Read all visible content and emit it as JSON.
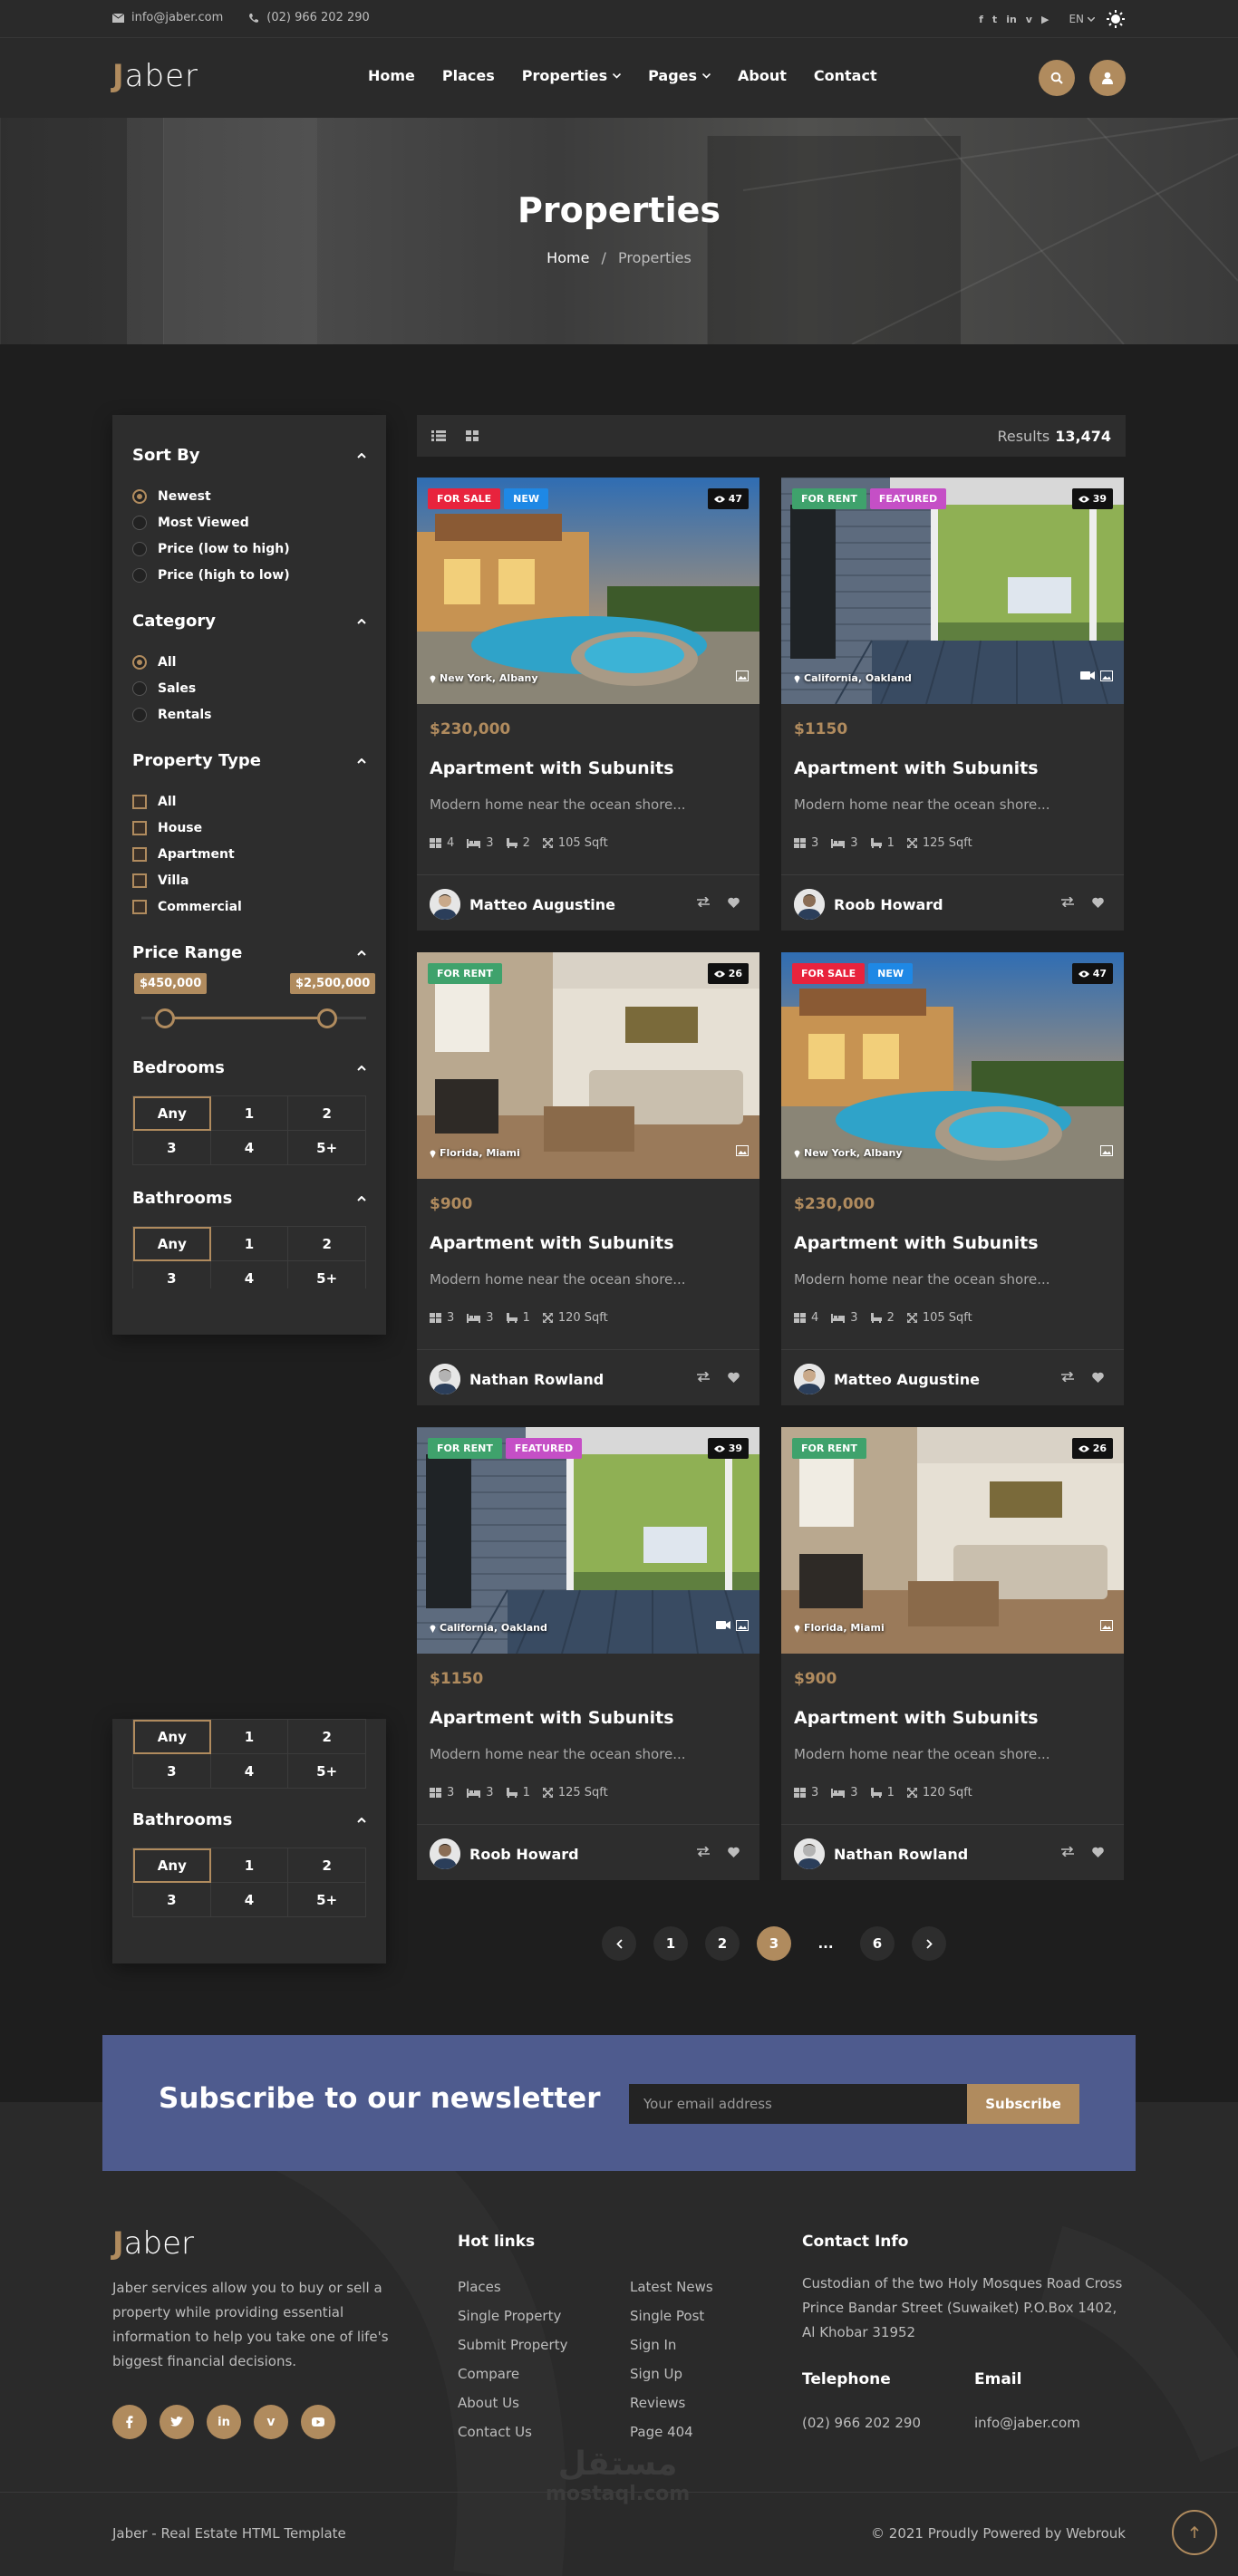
{
  "topbar": {
    "email": "info@jaber.com",
    "phone": "(02) 966 202 290",
    "lang": "EN"
  },
  "header": {
    "logo_initial": "J",
    "logo_rest": "aber",
    "nav": [
      "Home",
      "Places",
      "Properties",
      "Pages",
      "About",
      "Contact"
    ]
  },
  "hero": {
    "title": "Properties",
    "crumb_home": "Home",
    "crumb_sep": "/",
    "crumb_current": "Properties"
  },
  "sidebar": {
    "sort_title": "Sort By",
    "sort": [
      "Newest",
      "Most Viewed",
      "Price (low to high)",
      "Price (high to low)"
    ],
    "cat_title": "Category",
    "cats": [
      "All",
      "Sales",
      "Rentals"
    ],
    "type_title": "Property Type",
    "types": [
      "All",
      "House",
      "Apartment",
      "Villa",
      "Commercial"
    ],
    "price_title": "Price Range",
    "price_min": "$450,000",
    "price_max": "$2,500,000",
    "bed_title": "Bedrooms",
    "bath_title": "Bathrooms",
    "opts": [
      "Any",
      "1",
      "2",
      "3",
      "4",
      "5+"
    ]
  },
  "results": {
    "label": "Results",
    "count": "13,474"
  },
  "cards": [
    {
      "b1": "FOR SALE",
      "b2": "NEW",
      "views": "47",
      "loc": "New York, Albany",
      "price": "$230,000",
      "title": "Apartment with Subunits",
      "desc": "Modern home near the ocean shore...",
      "f1": "4",
      "f2": "3",
      "f3": "2",
      "f4": "105 Sqft",
      "agent": "Matteo Augustine"
    },
    {
      "b1": "FOR RENT",
      "b2": "FEATURED",
      "views": "39",
      "loc": "California, Oakland",
      "price": "$1150",
      "title": "Apartment with Subunits",
      "desc": "Modern home near the ocean shore...",
      "f1": "3",
      "f2": "3",
      "f3": "1",
      "f4": "125 Sqft",
      "agent": "Roob Howard"
    },
    {
      "b1": "FOR RENT",
      "b2": "",
      "views": "26",
      "loc": "Florida, Miami",
      "price": "$900",
      "title": "Apartment with Subunits",
      "desc": "Modern home near the ocean shore...",
      "f1": "3",
      "f2": "3",
      "f3": "1",
      "f4": "120 Sqft",
      "agent": "Nathan Rowland"
    },
    {
      "b1": "FOR SALE",
      "b2": "NEW",
      "views": "47",
      "loc": "New York, Albany",
      "price": "$230,000",
      "title": "Apartment with Subunits",
      "desc": "Modern home near the ocean shore...",
      "f1": "4",
      "f2": "3",
      "f3": "2",
      "f4": "105 Sqft",
      "agent": "Matteo Augustine"
    },
    {
      "b1": "FOR RENT",
      "b2": "FEATURED",
      "views": "39",
      "loc": "California, Oakland",
      "price": "$1150",
      "title": "Apartment with Subunits",
      "desc": "Modern home near the ocean shore...",
      "f1": "3",
      "f2": "3",
      "f3": "1",
      "f4": "125 Sqft",
      "agent": "Roob Howard"
    },
    {
      "b1": "FOR RENT",
      "b2": "",
      "views": "26",
      "loc": "Florida, Miami",
      "price": "$900",
      "title": "Apartment with Subunits",
      "desc": "Modern home near the ocean shore...",
      "f1": "3",
      "f2": "3",
      "f3": "1",
      "f4": "120 Sqft",
      "agent": "Nathan Rowland"
    }
  ],
  "pagination": [
    "1",
    "2",
    "3",
    "...",
    "6"
  ],
  "newsletter": {
    "title": "Subscribe to our newsletter",
    "placeholder": "Your email address",
    "button": "Subscribe"
  },
  "footer": {
    "about": "Jaber services allow you to buy or sell a property while providing essential information to help you take one of life's biggest financial decisions.",
    "hot_title": "Hot links",
    "links1": [
      "Places",
      "Single Property",
      "Submit Property",
      "Compare",
      "About Us",
      "Contact Us"
    ],
    "links2": [
      "Latest News",
      "Single Post",
      "Sign In",
      "Sign Up",
      "Reviews",
      "Page 404"
    ],
    "contact_title": "Contact Info",
    "address": "Custodian of the two Holy Mosques Road Cross Prince Bandar Street (Suwaiket) P.O.Box 1402, Al Khobar 31952",
    "tel_title": "Telephone",
    "tel": "(02) 966 202 290",
    "email_title": "Email",
    "email": "info@jaber.com",
    "copy_left": "Jaber - Real Estate HTML Template",
    "copy_right": "© 2021 Proudly Powered by Webrouk",
    "wm_ar": "مستقل",
    "wm_en": "mostaql.com"
  },
  "colors": {
    "accent": "#b08b5e",
    "bg": "#1e1e1e",
    "panel": "#2d2d2d",
    "newsletter": "#4e5b8e"
  }
}
